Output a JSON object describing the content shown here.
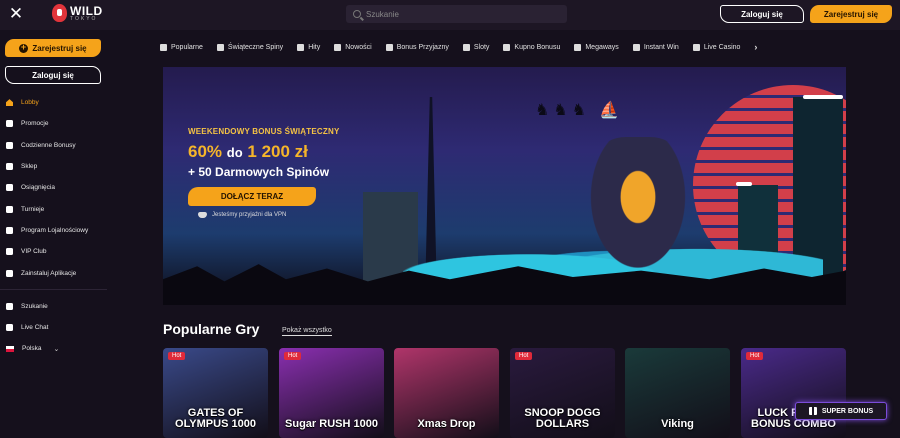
{
  "header": {
    "logo_word": "WILD",
    "logo_sub": "TOKYO",
    "search_placeholder": "Szukanie",
    "login_label": "Zaloguj się",
    "register_label": "Zarejestruj się"
  },
  "sidebar": {
    "register_label": "Zarejestruj się",
    "login_label": "Zaloguj się",
    "items": [
      {
        "label": "Lobby",
        "icon": "home-icon"
      },
      {
        "label": "Promocje",
        "icon": "megaphone-icon"
      },
      {
        "label": "Codzienne Bonusy",
        "icon": "calendar-icon"
      },
      {
        "label": "Sklep",
        "icon": "shop-icon"
      },
      {
        "label": "Osiągnięcia",
        "icon": "trophy-icon"
      },
      {
        "label": "Turnieje",
        "icon": "cup-icon"
      },
      {
        "label": "Program Lojalnościowy",
        "icon": "loyalty-icon"
      },
      {
        "label": "VIP Club",
        "icon": "crown-icon"
      },
      {
        "label": "Zainstaluj Aplikacje",
        "icon": "phone-icon"
      }
    ],
    "bottom_items": [
      {
        "label": "Szukanie",
        "icon": "search-icon"
      },
      {
        "label": "Live Chat",
        "icon": "chat-icon"
      },
      {
        "label": "Polska",
        "icon": "flag-pl-icon"
      }
    ]
  },
  "categories": [
    "Popularne",
    "Świąteczne Spiny",
    "Hity",
    "Nowości",
    "Bonus Przyjazny",
    "Sloty",
    "Kupno Bonusu",
    "Megaways",
    "Instant Win",
    "Live Casino"
  ],
  "banner": {
    "label": "WEEKENDOWY BONUS ŚWIĄTECZNY",
    "percent": "60%",
    "to": "do",
    "amount": "1 200 zł",
    "spins": "+ 50 Darmowych Spinów",
    "cta": "DOŁĄCZ TERAZ",
    "vpn_note": "Jesteśmy przyjaźni dla VPN"
  },
  "section": {
    "title": "Popularne Gry",
    "show_all": "Pokaż wszystko"
  },
  "games": [
    {
      "title": "GATES OF OLYMPUS 1000",
      "badge": "Hot",
      "bg": "#3a4a8a"
    },
    {
      "title": "Sugar RUSH 1000",
      "badge": "Hot",
      "bg": "#8a2fb0"
    },
    {
      "title": "Xmas Drop",
      "badge": "",
      "bg": "#b0356a"
    },
    {
      "title": "SNOOP DOGG DOLLARS",
      "badge": "Hot",
      "bg": "#2a1a3e"
    },
    {
      "title": "Viking",
      "badge": "",
      "bg": "#1a3a3a"
    },
    {
      "title": "LUCK PANDA BONUS COMBO",
      "badge": "Hot",
      "bg": "#4a2a8a"
    }
  ],
  "super_bonus": "SUPER BONUS",
  "colors": {
    "accent": "#f5a31a",
    "background": "#15101c",
    "hot": "#e02a3a"
  }
}
